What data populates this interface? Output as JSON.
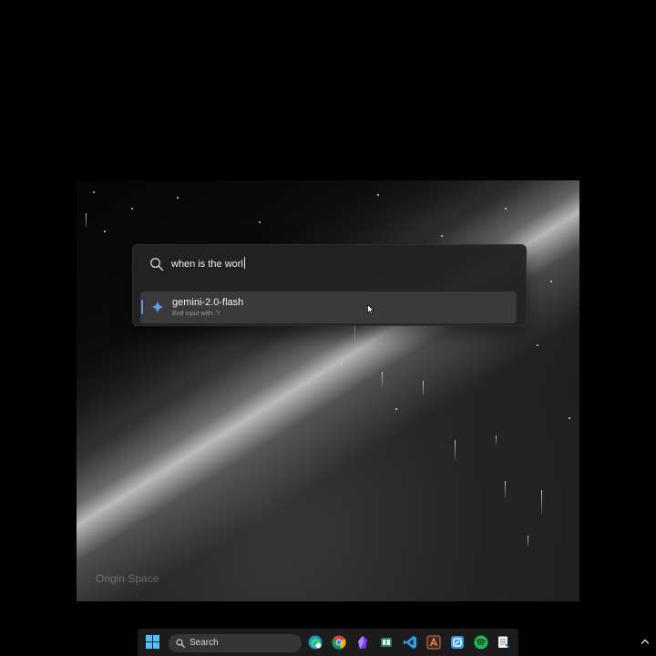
{
  "launcher": {
    "query": "when is the worl",
    "results": [
      {
        "title": "gemini-2.0-flash",
        "subtitle": "End input with: '\\'"
      }
    ]
  },
  "wallpaper": {
    "watermark": "Origin Space"
  },
  "taskbar": {
    "search_label": "Search",
    "apps": [
      "edge-icon",
      "chrome-icon",
      "obsidian-icon",
      "reader-app-icon",
      "vscode-icon",
      "office-app-icon",
      "sync-app-icon",
      "spotify-icon",
      "notepad-app-icon"
    ]
  },
  "colors": {
    "accent": "#4f9de8",
    "start_blue": "#4cc2ff",
    "spotify_green": "#1db954"
  }
}
